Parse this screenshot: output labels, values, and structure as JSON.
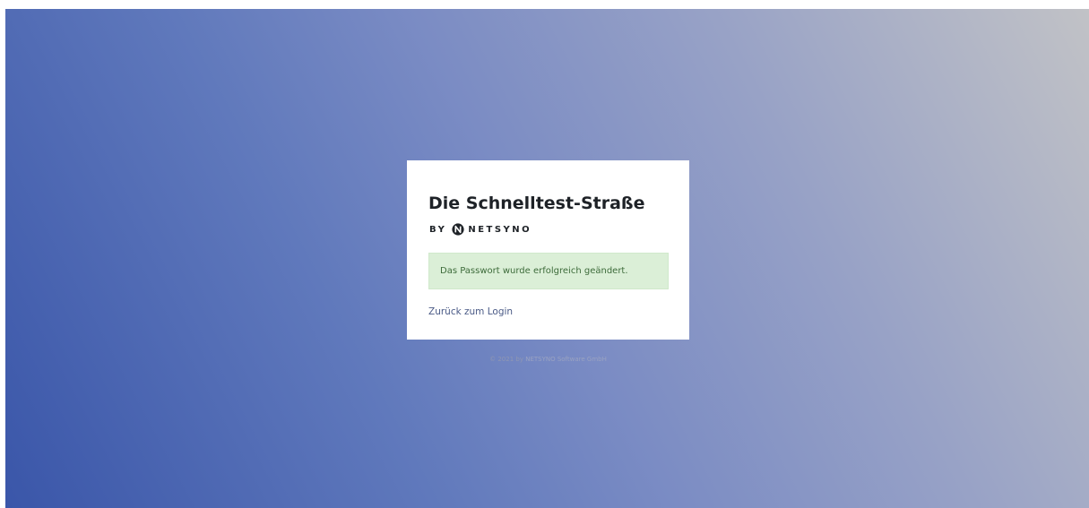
{
  "app": {
    "title": "Die Schnelltest-Straße",
    "by": "BY",
    "brand_name": "NETSYNO",
    "logo_icon": "netsyno-logo-icon"
  },
  "alert": {
    "message": "Das Passwort wurde erfolgreich geändert.",
    "color": "#dbefd7"
  },
  "links": {
    "back_to_login": "Zurück zum Login"
  },
  "footer": {
    "copyright": "© 2021 by",
    "company_link": "NETSYNO Software GmbH"
  },
  "colors": {
    "gradient_start": "#3a56a9",
    "gradient_end": "#c1c2c6",
    "alert_text": "#3d6b3a",
    "link": "#4a5a86"
  }
}
